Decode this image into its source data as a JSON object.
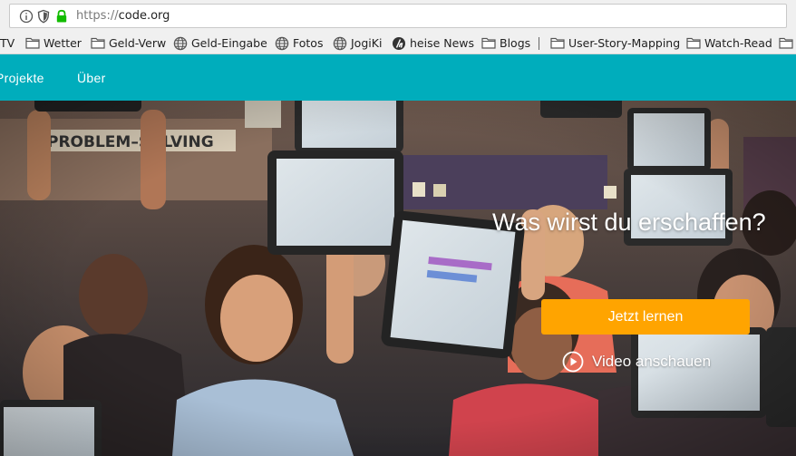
{
  "browser": {
    "url_scheme": "https://",
    "url_host": "code.org",
    "icons": [
      "info-icon",
      "shield-icon",
      "lock-icon"
    ]
  },
  "bookmarks": [
    {
      "label": "TV",
      "icon": "none"
    },
    {
      "label": "Wetter",
      "icon": "folder-icon"
    },
    {
      "label": "Geld-Verw",
      "icon": "folder-icon"
    },
    {
      "label": "Geld-Eingabe",
      "icon": "globe-icon"
    },
    {
      "label": "Fotos",
      "icon": "globe-icon"
    },
    {
      "label": "JogiKi",
      "icon": "globe-icon"
    },
    {
      "label": "heise News",
      "icon": "heise-icon"
    },
    {
      "label": "Blogs",
      "icon": "folder-icon"
    },
    {
      "label": "User-Story-Mapping",
      "icon": "folder-icon"
    },
    {
      "label": "Watch-Read",
      "icon": "folder-icon"
    }
  ],
  "site": {
    "brand_color": "#00adbc",
    "nav": [
      "Projekte",
      "Über"
    ],
    "hero": {
      "title": "Was wirst du erschaffen?",
      "cta_label": "Jetzt lernen",
      "cta_color": "#ffa400",
      "video_label": "Video anschauen"
    }
  }
}
